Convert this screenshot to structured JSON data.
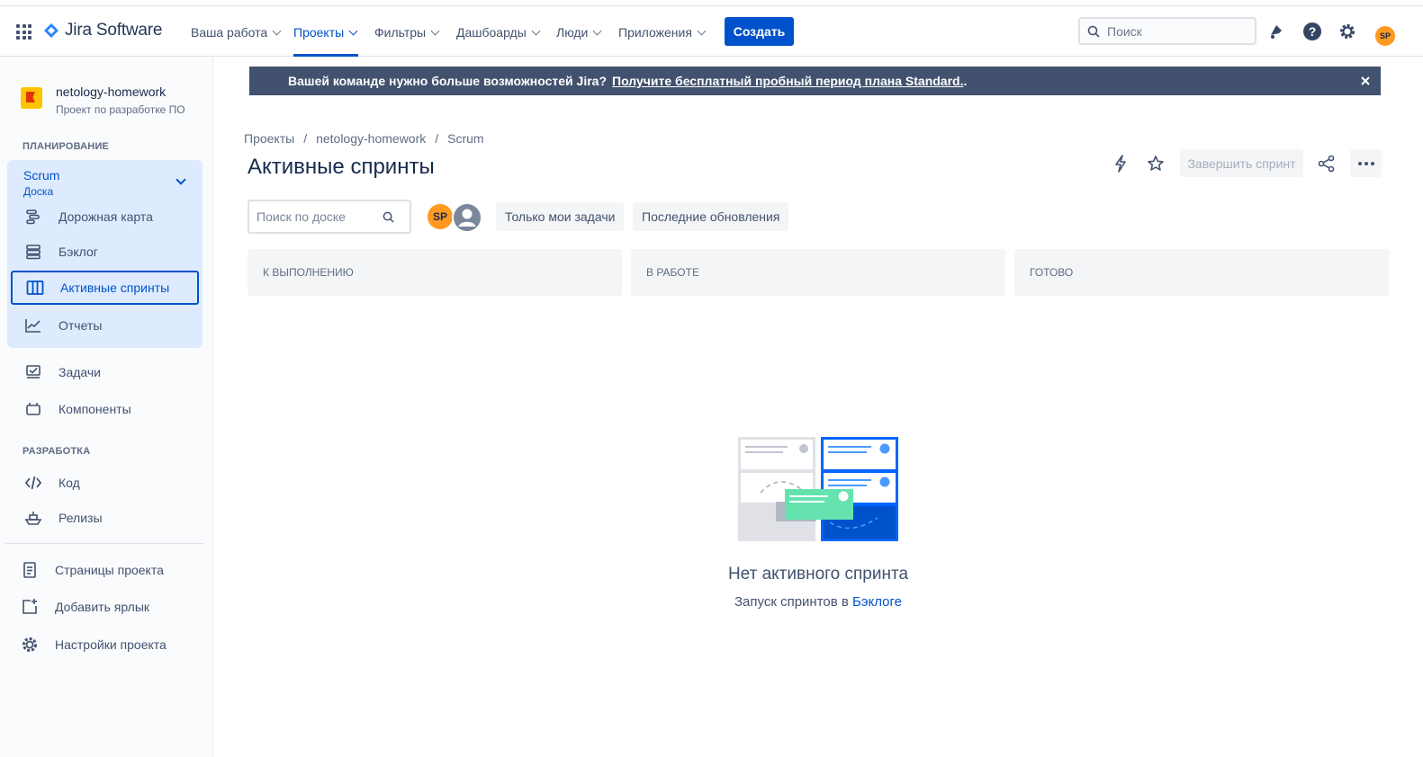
{
  "topnav": {
    "brand": "Jira Software",
    "menu": [
      {
        "label": "Ваша работа"
      },
      {
        "label": "Проекты"
      },
      {
        "label": "Фильтры"
      },
      {
        "label": "Дашбоарды"
      },
      {
        "label": "Люди"
      },
      {
        "label": "Приложения"
      }
    ],
    "create_label": "Создать",
    "search_placeholder": "Поиск",
    "user_initials": "SP"
  },
  "sidebar": {
    "project_name": "netology-homework",
    "project_type": "Проект по разработке ПО",
    "planning_title": "ПЛАНИРОВАНИЕ",
    "board_name": "Scrum",
    "board_sub": "Доска",
    "planning_items": [
      {
        "label": "Дорожная карта"
      },
      {
        "label": "Бэклог"
      },
      {
        "label": "Активные спринты"
      },
      {
        "label": "Отчеты"
      }
    ],
    "other_items": [
      {
        "label": "Задачи"
      },
      {
        "label": "Компоненты"
      }
    ],
    "dev_title": "РАЗРАБОТКА",
    "dev_items": [
      {
        "label": "Код"
      },
      {
        "label": "Релизы"
      }
    ],
    "footer_items": [
      {
        "label": "Страницы проекта"
      },
      {
        "label": "Добавить ярлык"
      },
      {
        "label": "Настройки проекта"
      }
    ]
  },
  "banner": {
    "text": "Вашей команде нужно больше возможностей Jira?",
    "link": "Получите бесплатный пробный период плана Standard.",
    "suffix": "."
  },
  "breadcrumb": [
    "Проекты",
    "/",
    "netology-homework",
    "/",
    "Scrum"
  ],
  "page_title": "Активные спринты",
  "complete_sprint_label": "Завершить спринт",
  "board": {
    "search_placeholder": "Поиск по доске",
    "avatar_initials": "SP",
    "filters": [
      "Только мои задачи",
      "Последние обновления"
    ],
    "columns": [
      "К ВЫПОЛНЕНИЮ",
      "В РАБОТЕ",
      "ГОТОВО"
    ]
  },
  "empty": {
    "title": "Нет активного спринта",
    "subtitle_prefix": "Запуск спринтов в ",
    "subtitle_link": "Бэклоге"
  },
  "colors": {
    "brand_blue": "#0052cc",
    "banner_bg": "#42526e",
    "avatar_orange": "#ff991f",
    "selected_bg": "#deebff"
  }
}
